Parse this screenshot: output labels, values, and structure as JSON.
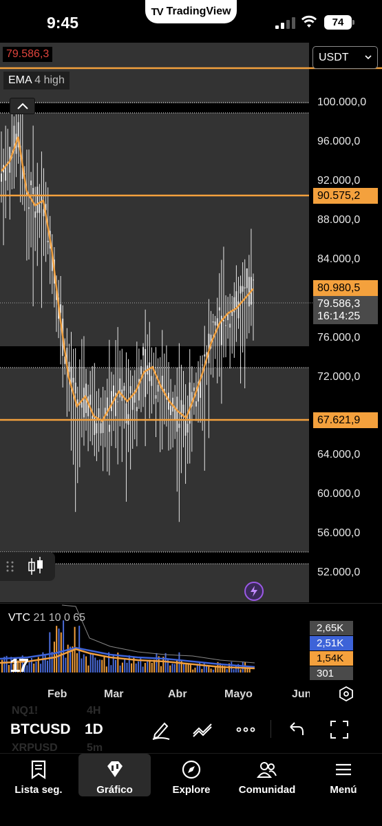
{
  "status_bar": {
    "time": "9:45",
    "app_name": "TradingView",
    "battery": "74"
  },
  "chart": {
    "last_price_tag": "79.586,3",
    "indicator": {
      "name": "EMA",
      "params": "4 high"
    },
    "currency": "USDT",
    "price_axis": [
      "100.000,0",
      "96.000,0",
      "92.000,0",
      "88.000,0",
      "84.000,0",
      "76.000,0",
      "72.000,0",
      "64.000,0",
      "60.000,0",
      "56.000,0",
      "52.000,0"
    ],
    "price_axis_partial_top": "",
    "badges": {
      "line_90": "90.575,2",
      "ema_value": "80.980,5",
      "last_price": "79.586,3",
      "countdown": "16:14:25",
      "line_67": "67.621,9"
    },
    "horizontal_levels": [
      100300,
      90575.2,
      67621.9
    ],
    "colors": {
      "background": "#333333",
      "level_line": "#f4a13d",
      "ema": "#f0a040",
      "candle": "#e8e8e8",
      "last_price": "#e0443c",
      "volume_up": "#f4a13d",
      "volume_down": "#4a6bd8"
    }
  },
  "chart_data": {
    "type": "line",
    "x": [
      "Feb",
      "Mar",
      "Abr",
      "Mayo",
      "Jun"
    ],
    "price_range": [
      50000,
      102000
    ],
    "series": [
      {
        "name": "EMA",
        "values": [
          93000,
          94000,
          96500,
          91000,
          89500,
          90000,
          85000,
          78000,
          72000,
          69000,
          70000,
          68000,
          67500,
          69000,
          70500,
          69500,
          70500,
          72500,
          73000,
          71000,
          69500,
          68500,
          67800,
          70000,
          72500,
          75500,
          77500,
          78500,
          79000,
          80000,
          81000
        ]
      }
    ]
  },
  "volume": {
    "indicator": {
      "name": "VTC",
      "params": "21 10 0 65"
    },
    "badges": [
      "2,65K",
      "2,51K",
      "1,54K",
      "301"
    ],
    "badge_colors": [
      "#4a4a4a",
      "#3d63d8",
      "#f4a13d",
      "#4a4a4a"
    ],
    "watermark": "17"
  },
  "time_axis": {
    "labels": [
      "Feb",
      "Mar",
      "Abr",
      "Mayo",
      "Jun"
    ]
  },
  "symbol_bar": {
    "symbol": "BTCUSD",
    "interval": "1D",
    "ghost_above": {
      "symbol": "NQ1!",
      "interval": "4H"
    },
    "ghost_below": {
      "symbol": "XRPUSD",
      "interval": "5m"
    },
    "tools": [
      "pencil-icon",
      "trend-icon",
      "more-icon",
      "undo-icon",
      "fullscreen-icon"
    ]
  },
  "nav": {
    "items": [
      {
        "label": "Lista seg.",
        "icon": "watchlist-icon"
      },
      {
        "label": "Gráfico",
        "icon": "chart-icon",
        "active": true
      },
      {
        "label": "Explore",
        "icon": "compass-icon"
      },
      {
        "label": "Comunidad",
        "icon": "community-icon"
      },
      {
        "label": "Menú",
        "icon": "menu-icon"
      }
    ]
  }
}
